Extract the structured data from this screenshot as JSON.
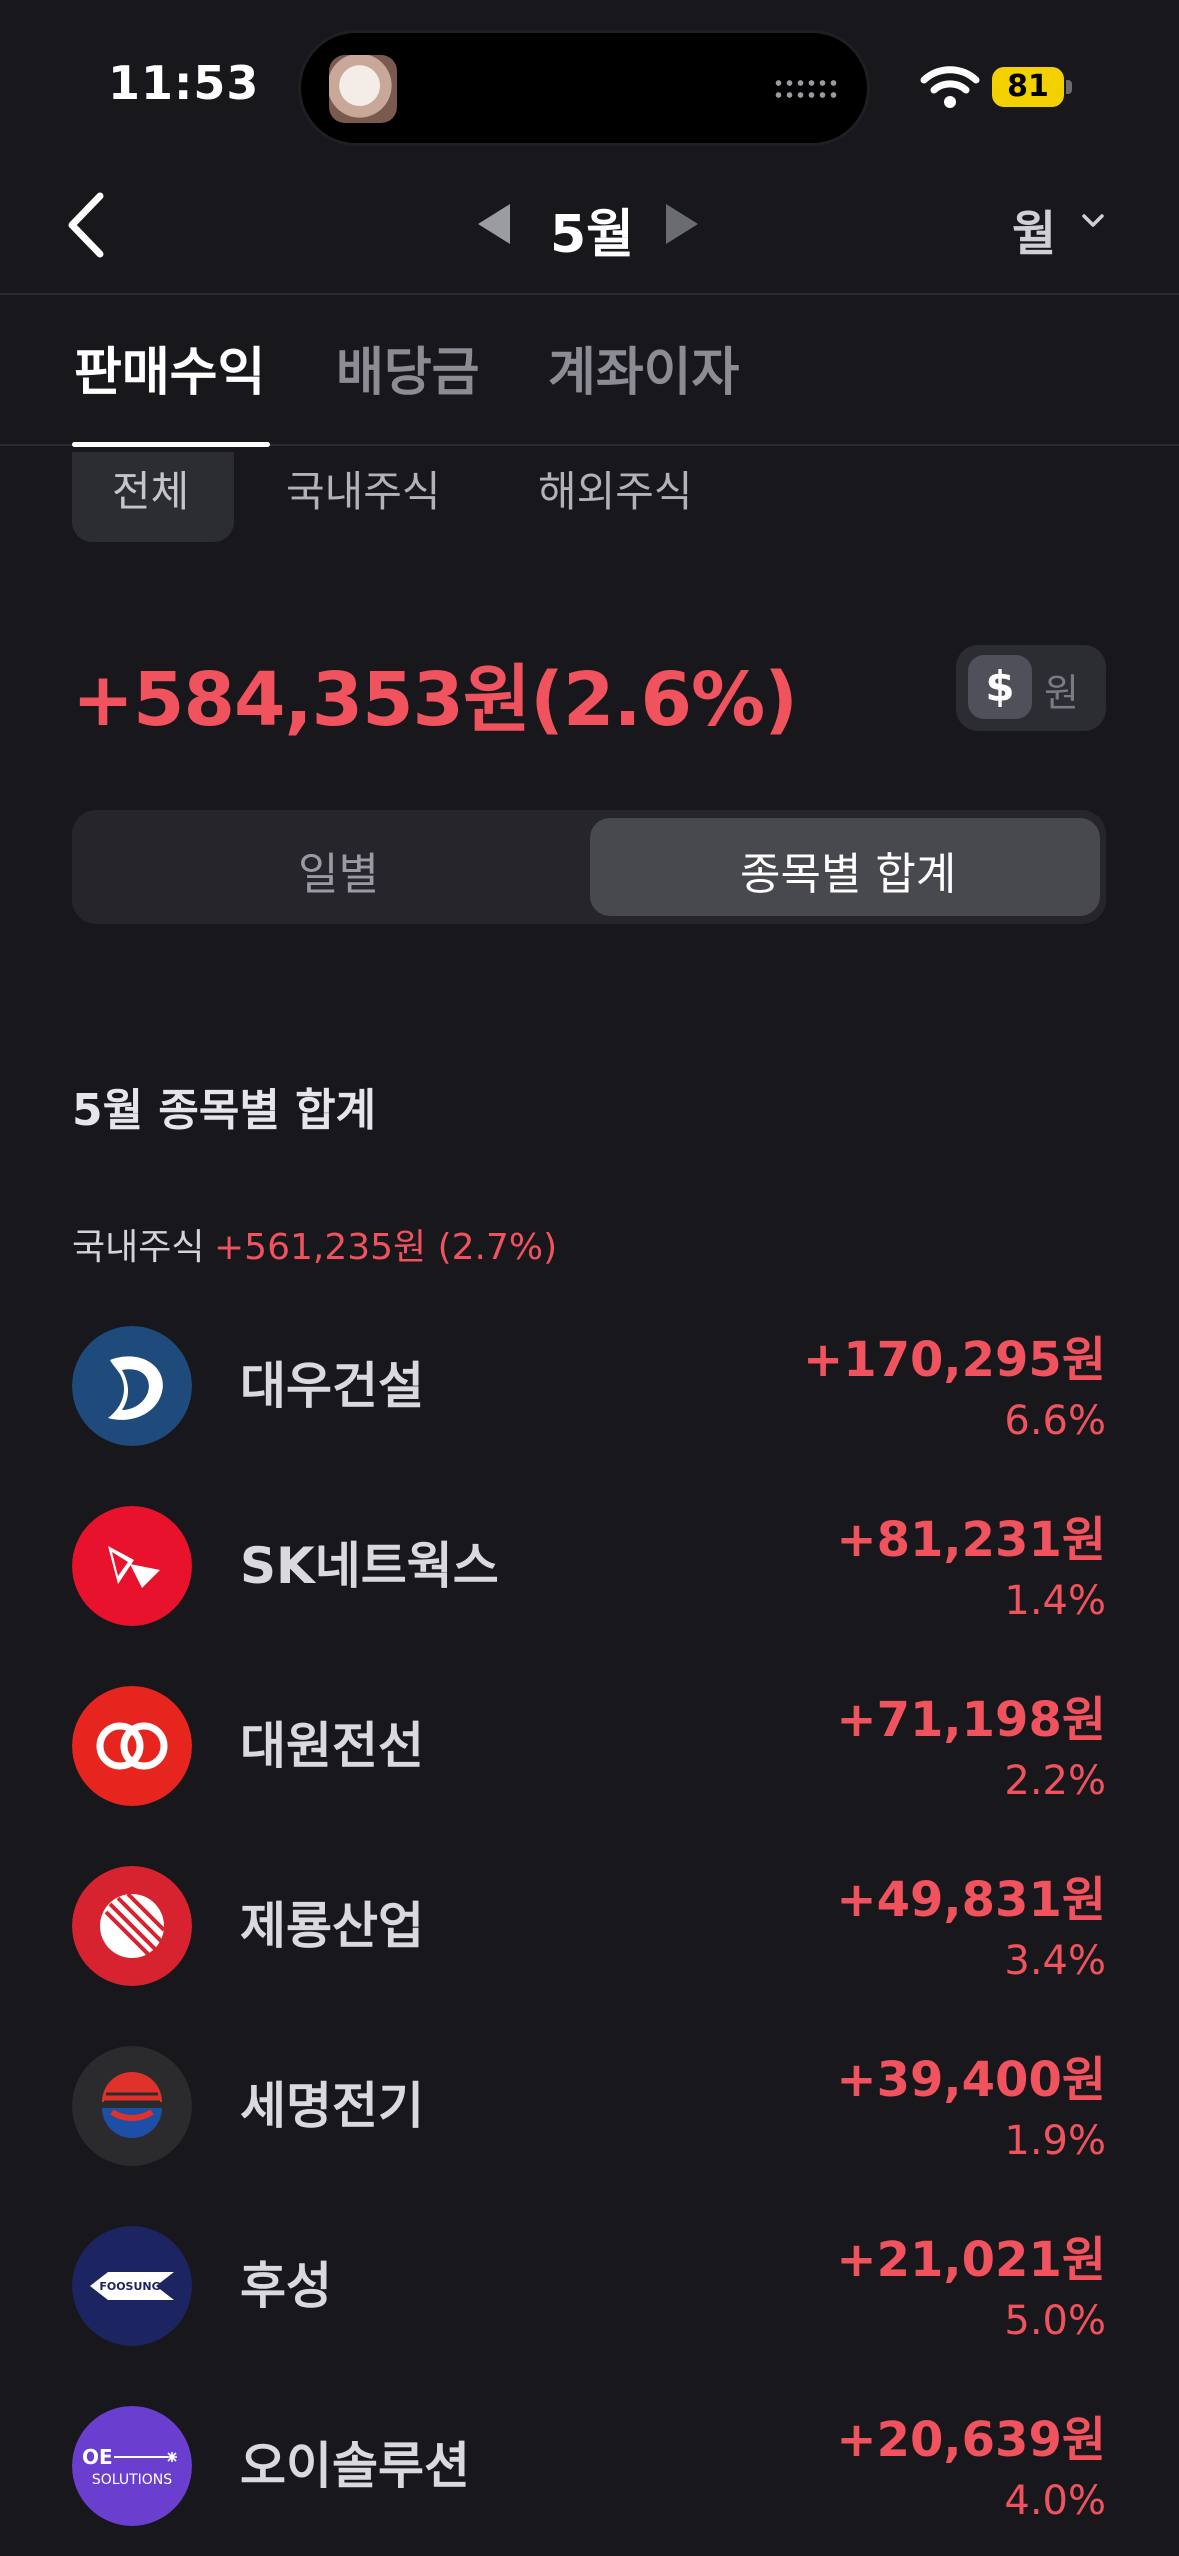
{
  "status_bar": {
    "time": "11:53",
    "battery": "81"
  },
  "header": {
    "month": "5월",
    "period_select": "월"
  },
  "tabs": [
    {
      "label": "판매수익",
      "active": true
    },
    {
      "label": "배당금",
      "active": false
    },
    {
      "label": "계좌이자",
      "active": false
    }
  ],
  "subtabs": [
    {
      "label": "전체",
      "active": true
    },
    {
      "label": "국내주식",
      "active": false
    },
    {
      "label": "해외주식",
      "active": false
    }
  ],
  "total": {
    "value": "+584,353원(2.6%)"
  },
  "currency_toggle": {
    "dollar": "$",
    "won": "원",
    "selected": "won"
  },
  "segment": {
    "daily": "일별",
    "by_stock": "종목별 합계",
    "selected": "by_stock"
  },
  "summary": {
    "title": "5월 종목별 합계",
    "group_label": "국내주식",
    "group_value": "+561,235원 (2.7%)"
  },
  "stocks": [
    {
      "name": "대우건설",
      "amount": "+170,295원",
      "percent": "6.6%",
      "logo": "daewoo-logo"
    },
    {
      "name": "SK네트웍스",
      "amount": "+81,231원",
      "percent": "1.4%",
      "logo": "sk-logo"
    },
    {
      "name": "대원전선",
      "amount": "+71,198원",
      "percent": "2.2%",
      "logo": "daewon-logo"
    },
    {
      "name": "제룡산업",
      "amount": "+49,831원",
      "percent": "3.4%",
      "logo": "jeryong-logo"
    },
    {
      "name": "세명전기",
      "amount": "+39,400원",
      "percent": "1.9%",
      "logo": "semyung-logo"
    },
    {
      "name": "후성",
      "amount": "+21,021원",
      "percent": "5.0%",
      "logo": "foosung-logo",
      "logo_text": "FOOSUNG"
    },
    {
      "name": "오이솔루션",
      "amount": "+20,639원",
      "percent": "4.0%",
      "logo": "oe-solutions-logo",
      "logo_text": [
        "OE",
        "SOLUTIONS"
      ]
    }
  ],
  "colors": {
    "background": "#18171c",
    "positive": "#f0525e",
    "battery": "#f3d100"
  }
}
